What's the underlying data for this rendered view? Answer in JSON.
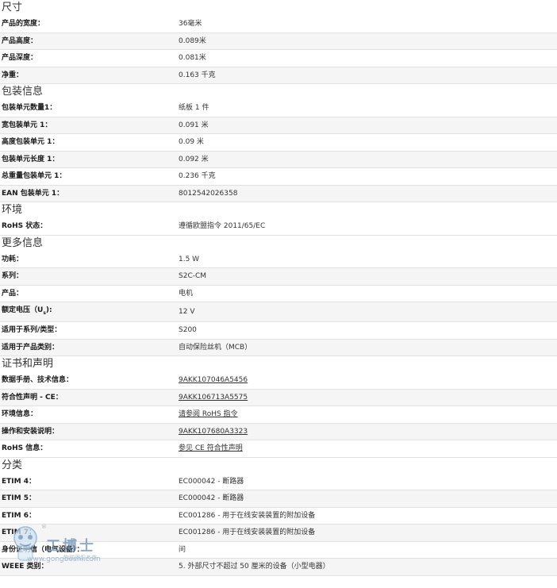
{
  "sections": [
    {
      "title": "尺寸",
      "rows": [
        {
          "k": "产品的宽度：",
          "v": "36毫米"
        },
        {
          "k": "产品高度：",
          "v": "0.089米"
        },
        {
          "k": "产品深度：",
          "v": "0.081米"
        },
        {
          "k": "净重：",
          "v": "0.163 千克"
        }
      ]
    },
    {
      "title": "包装信息",
      "rows": [
        {
          "k": "包装单元数量1：",
          "v": "纸板 1 件"
        },
        {
          "k": "宽包装单元 1：",
          "v": "0.091 米"
        },
        {
          "k": "高度包装单元 1：",
          "v": "0.09 米"
        },
        {
          "k": "包装单元长度 1：",
          "v": "0.092 米"
        },
        {
          "k": "总重量包装单元 1：",
          "v": "0.236 千克"
        },
        {
          "k": "EAN 包装单元 1：",
          "v": "8012542026358"
        }
      ]
    },
    {
      "title": "环境",
      "rows": [
        {
          "k": "RoHS 状态：",
          "v": "遵循欧盟指令 2011/65/EC"
        }
      ]
    },
    {
      "title": "更多信息",
      "rows": [
        {
          "k": "功耗：",
          "v": "1.5 W"
        },
        {
          "k": "系列：",
          "v": "S2C-CM"
        },
        {
          "k": "产品：",
          "v": "电机"
        },
        {
          "k": "额定电压（U",
          "k_sub": "s",
          "k_after": "):",
          "v": "12 V"
        },
        {
          "k": "适用于系列/类型：",
          "v": "S200"
        },
        {
          "k": "适用于产品类别：",
          "v": "自动保险丝机（MCB）"
        }
      ]
    },
    {
      "title": "证书和声明",
      "rows": [
        {
          "k": "数据手册、技术信息：",
          "v": "9AKK107046A5456",
          "link": true
        },
        {
          "k": "符合性声明 - CE：",
          "v": "9AKK106713A5575",
          "link": true
        },
        {
          "k": "环境信息：",
          "v": "请参阅 RoHS 指令",
          "link": true
        },
        {
          "k": "操作和安装说明：",
          "v": "9AKK107680A3323",
          "link": true
        },
        {
          "k": "RoHS 信息：",
          "v": "参见 CE 符合性声明",
          "link": true
        }
      ]
    },
    {
      "title": "分类",
      "rows": [
        {
          "k": "ETIM 4：",
          "v": "EC000042 - 断路器"
        },
        {
          "k": "ETIM 5：",
          "v": "EC000042 - 断路器"
        },
        {
          "k": "ETIM 6：",
          "v": "EC001286 - 用于在线安装装置的附加设备"
        },
        {
          "k": "ETIM 7：",
          "v": "EC001286 - 用于在线安装装置的附加设备"
        },
        {
          "k": "身份证明信（电气设备）：",
          "v": "问"
        },
        {
          "k": "WEEE 类别：",
          "v": "5. 外部尺寸不超过 50 厘米的设备（小型电器）"
        }
      ]
    }
  ],
  "watermark": {
    "brand": "工博士",
    "url": "www.gongboshi.com",
    "subtitle": "物联网服务商",
    "registered": "®"
  }
}
